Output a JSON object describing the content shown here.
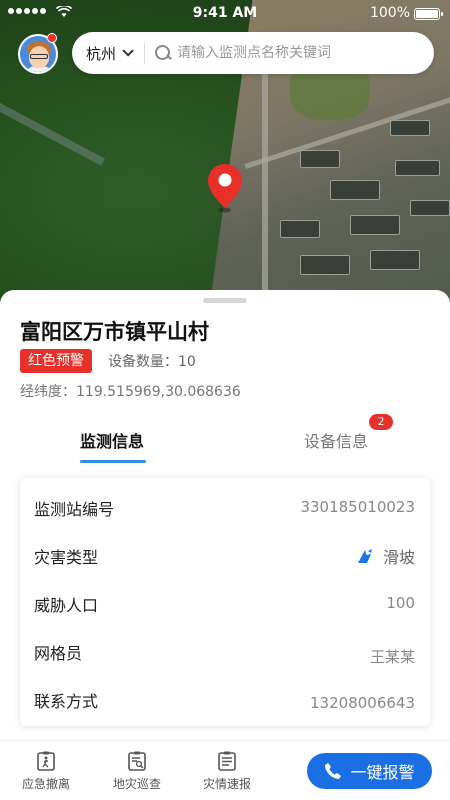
{
  "status_bar": {
    "time": "9:41 AM",
    "battery": "100%"
  },
  "header": {
    "city": "杭州",
    "search_placeholder": "请输入监测点名称关键词"
  },
  "place": {
    "title": "富阳区万市镇平山村",
    "warning_level": "红色预警",
    "device_count": "设备数量：10",
    "coordinates": "经纬度：119.515969,30.068636"
  },
  "tabs": [
    {
      "label": "监测信息",
      "active": true
    },
    {
      "label": "设备信息",
      "active": false,
      "badge": "2"
    }
  ],
  "info": [
    {
      "label": "监测站编号",
      "value": "330185010023"
    },
    {
      "label": "灾害类型",
      "value": "滑坡",
      "icon": "landslide-icon"
    },
    {
      "label": "威胁人口",
      "value": "100"
    },
    {
      "label": "网格员",
      "value": "王某某"
    },
    {
      "label": "联系方式",
      "value": "13208006643"
    }
  ],
  "bottom_nav": {
    "evac": "应急撤离",
    "patrol": "地灾巡查",
    "report": "灾情速报",
    "sos": "一键报警"
  },
  "colors": {
    "accent": "#1a6fe4",
    "warning": "#e8302b",
    "tab_active": "#2f8fe6"
  }
}
